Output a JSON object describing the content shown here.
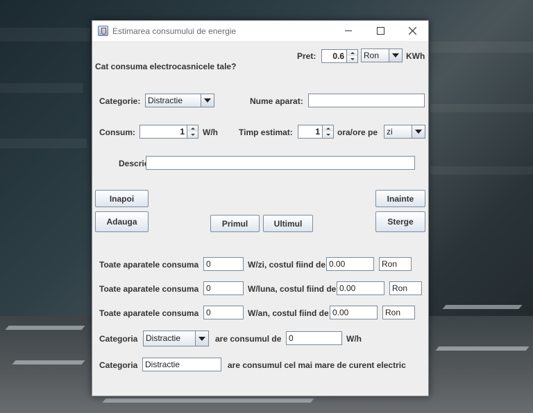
{
  "window": {
    "title": "Estimarea consumului de energie"
  },
  "header": {
    "question": "Cat consuma electrocasnicele tale?",
    "price_label": "Pret:",
    "price_value": "0.6",
    "currency_selected": "Ron",
    "unit_label": "KWh"
  },
  "form": {
    "category_label": "Categorie:",
    "category_selected": "Distractie",
    "device_name_label": "Nume aparat:",
    "device_name_value": "",
    "consumption_label": "Consum:",
    "consumption_value": "1",
    "consumption_unit": "W/h",
    "time_label": "Timp estimat:",
    "time_value": "1",
    "time_unit": "ora/ore pe",
    "period_selected": "zi",
    "description_label": "Descriere:",
    "description_value": ""
  },
  "buttons": {
    "back": "Inapoi",
    "forward": "Inainte",
    "add": "Adauga",
    "delete": "Sterge",
    "first": "Primul",
    "last": "Ultimul"
  },
  "summary": {
    "all_label": "Toate aparatele consuma",
    "daily": {
      "value": "0",
      "unit_text": "W/zi, costul fiind de",
      "cost": "0.00",
      "currency": "Ron"
    },
    "monthly": {
      "value": "0",
      "unit_text": "W/luna, costul fiind de",
      "cost": "0.00",
      "currency": "Ron"
    },
    "yearly": {
      "value": "0",
      "unit_text": "W/an, costul fiind de",
      "cost": "0.00",
      "currency": "Ron"
    },
    "category_label": "Categoria",
    "category_selected": "Distractie",
    "category_consumption_text": "are consumul de",
    "category_consumption_value": "0",
    "category_consumption_unit": "W/h",
    "top_category_value": "Distractie",
    "top_category_text": "are consumul cel mai mare de curent electric"
  }
}
